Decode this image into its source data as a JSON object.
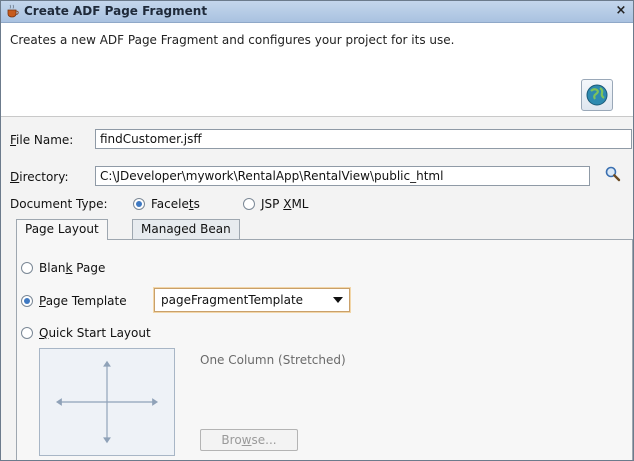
{
  "window": {
    "title": "Create ADF Page Fragment",
    "close_label": "×"
  },
  "header": {
    "description": "Creates a new ADF Page Fragment and configures your project for its use."
  },
  "form": {
    "file_name": {
      "label_prefix": "",
      "label_mnemonic": "F",
      "label_rest": "ile Name:",
      "value": "findCustomer.jsff"
    },
    "directory": {
      "label_mnemonic": "D",
      "label_rest": "irectory:",
      "value": "C:\\JDeveloper\\mywork\\RentalApp\\RentalView\\public_html"
    },
    "document_type": {
      "label": "Document Type:",
      "options": [
        {
          "before": "Facele",
          "mnemonic": "t",
          "after": "s",
          "selected": true
        },
        {
          "before": "JSP ",
          "mnemonic": "X",
          "after": "ML",
          "selected": false
        }
      ]
    }
  },
  "tabs": [
    {
      "label": "Page Layout",
      "active": true
    },
    {
      "label": "Managed Bean",
      "active": false
    }
  ],
  "page_layout": {
    "blank_page": {
      "before": "Blan",
      "mnemonic": "k",
      "after": " Page",
      "selected": false
    },
    "page_template": {
      "before": "",
      "mnemonic": "P",
      "after": "age Template",
      "selected": true,
      "template_value": "pageFragmentTemplate"
    },
    "quick_start": {
      "before": "",
      "mnemonic": "Q",
      "after": "uick Start Layout",
      "selected": false
    },
    "layout_name": "One Column (Stretched)",
    "browse": {
      "before": "Bro",
      "mnemonic": "w",
      "after": "se..."
    }
  }
}
